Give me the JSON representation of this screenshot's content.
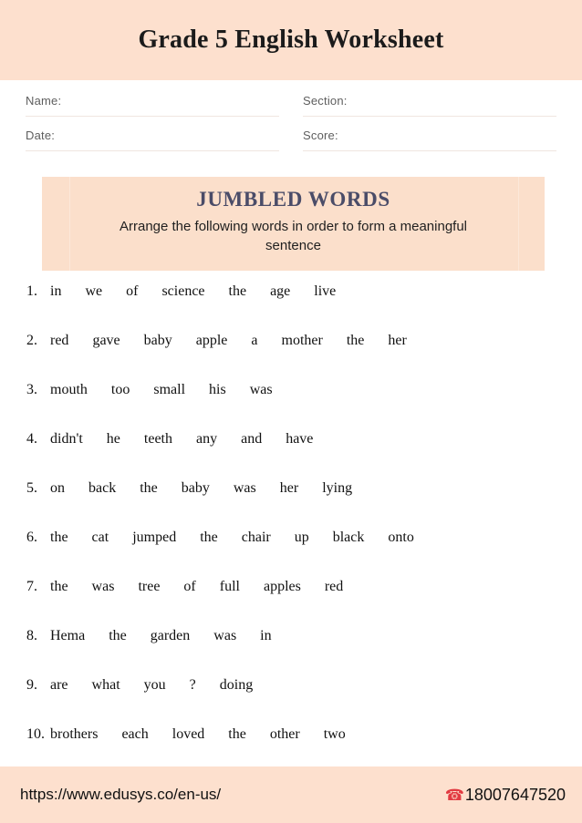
{
  "header": {
    "title": "Grade 5 English Worksheet",
    "background_color": "#fde0ce"
  },
  "meta_fields": {
    "name_label": "Name:",
    "section_label": "Section:",
    "date_label": "Date:",
    "score_label": "Score:"
  },
  "section": {
    "heading": "JUMBLED WORDS",
    "heading_color": "#4a4c68",
    "subtitle": "Arrange the following words in order to form a meaningful sentence",
    "background_color": "#fbdfcb"
  },
  "questions": [
    {
      "number": "1.",
      "words": [
        "in",
        "we",
        "of",
        "science",
        "the",
        "age",
        "live"
      ]
    },
    {
      "number": "2.",
      "words": [
        "red",
        "gave",
        "baby",
        "apple",
        "a",
        "mother",
        "the",
        "her"
      ]
    },
    {
      "number": "3.",
      "words": [
        "mouth",
        "too",
        "small",
        "his",
        "was"
      ]
    },
    {
      "number": "4.",
      "words": [
        "didn't",
        "he",
        "teeth",
        "any",
        "and",
        "have"
      ]
    },
    {
      "number": "5.",
      "words": [
        "on",
        "back",
        "the",
        "baby",
        "was",
        "her",
        "lying"
      ]
    },
    {
      "number": "6.",
      "words": [
        "the",
        "cat",
        "jumped",
        "the",
        "chair",
        "up",
        "black",
        "onto"
      ]
    },
    {
      "number": "7.",
      "words": [
        "the",
        "was",
        "tree",
        "of",
        "full",
        "apples",
        "red"
      ]
    },
    {
      "number": "8.",
      "words": [
        "Hema",
        "the",
        "garden",
        "was",
        "in"
      ]
    },
    {
      "number": "9.",
      "words": [
        "are",
        "what",
        "you",
        "?",
        "doing"
      ]
    },
    {
      "number": "10.",
      "words": [
        "brothers",
        "each",
        "loved",
        "the",
        "other",
        "two"
      ]
    }
  ],
  "footer": {
    "url": "https://www.edusys.co/en-us/",
    "phone_icon": "telephone-icon",
    "phone_glyph": "☎",
    "phone_number": "18007647520",
    "background_color": "#fde0ce",
    "phone_icon_color": "#e23b42"
  }
}
